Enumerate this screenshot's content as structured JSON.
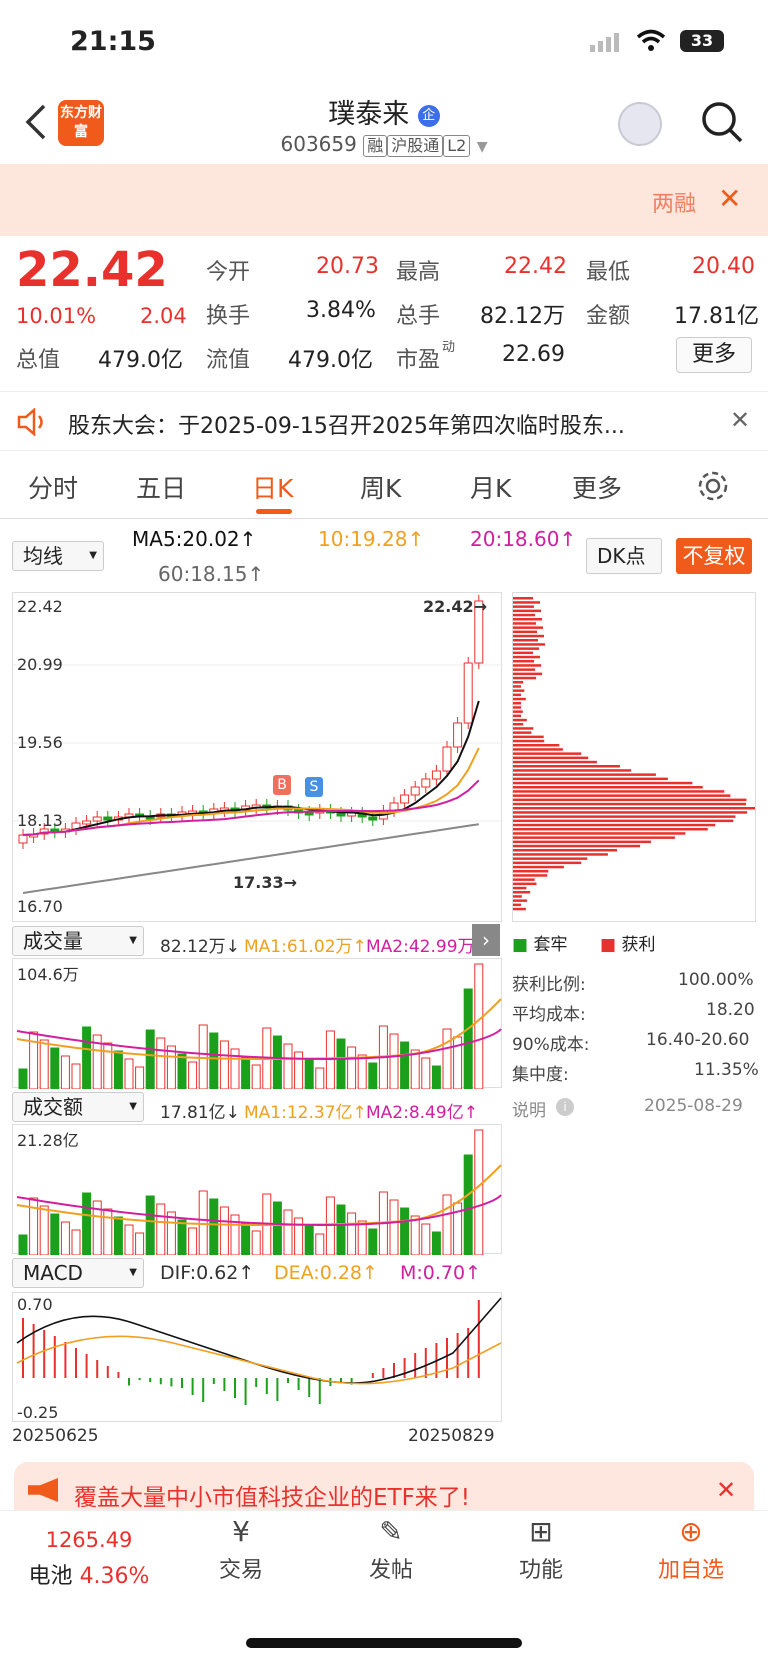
{
  "status": {
    "time": "21:15",
    "battery": "33"
  },
  "header": {
    "logo": "东方财富",
    "title": "璞泰来",
    "badge": "企",
    "code": "603659",
    "tags": [
      "融",
      "沪股通",
      "L2"
    ]
  },
  "banner": {
    "text": "两融"
  },
  "quote": {
    "price": "22.42",
    "pct": "10.01%",
    "chg": "2.04",
    "open_l": "今开",
    "open": "20.73",
    "high_l": "最高",
    "high": "22.42",
    "low_l": "最低",
    "low": "20.40",
    "turn_l": "换手",
    "turn": "3.84%",
    "vol_l": "总手",
    "vol": "82.12万",
    "amt_l": "金额",
    "amt": "17.81亿",
    "mcap_l": "总值",
    "mcap": "479.0亿",
    "float_l": "流值",
    "float": "479.0亿",
    "pe_l": "市盈",
    "pe_sup": "动",
    "pe": "22.69",
    "more": "更多"
  },
  "notice": {
    "text": "股东大会：于2025-09-15召开2025年第四次临时股东..."
  },
  "tabs": [
    "分时",
    "五日",
    "日K",
    "周K",
    "月K",
    "更多"
  ],
  "ma": {
    "select": "均线",
    "ma5": "MA5:20.02↑",
    "ma10": "10:19.28↑",
    "ma20": "20:18.60↑",
    "ma60": "60:18.15↑",
    "dk": "DK点",
    "fq": "不复权"
  },
  "kline": {
    "top": "22.42",
    "y2": "20.99",
    "y3": "19.56",
    "y4": "18.13",
    "bottom": "16.70",
    "hi_ann": "22.42→",
    "lo_ann": "17.33→",
    "b": "B",
    "s": "S"
  },
  "vol": {
    "select": "成交量",
    "val": "82.12万↓",
    "ma1": "MA1:61.02万↑",
    "ma2": "MA2:42.99万↑",
    "max": "104.6万"
  },
  "amt": {
    "select": "成交额",
    "val": "17.81亿↓",
    "ma1": "MA1:12.37亿↑",
    "ma2": "MA2:8.49亿↑",
    "max": "21.28亿"
  },
  "macd": {
    "select": "MACD",
    "dif": "DIF:0.62↑",
    "dea": "DEA:0.28↑",
    "m": "M:0.70↑",
    "top": "0.70",
    "bottom": "-0.25",
    "d1": "20250625",
    "d2": "20250829"
  },
  "chip": {
    "leg1": "套牢",
    "leg2": "获利",
    "r1l": "获利比例:",
    "r1": "100.00%",
    "r2l": "平均成本:",
    "r2": "18.20",
    "r3l": "90%成本:",
    "r3": "16.40-20.60",
    "r4l": "集中度:",
    "r4": "11.35%",
    "note": "说明",
    "date": "2025-08-29"
  },
  "ad": {
    "text": "覆盖大量中小市值科技企业的ETF来了!"
  },
  "bottom": {
    "index": "1265.49",
    "name": "电池",
    "pct": "4.36%",
    "items": [
      "交易",
      "发帖",
      "功能",
      "加自选"
    ]
  },
  "colors": {
    "up": "#e8312d",
    "down": "#1ca01c",
    "accent": "#f05a1a"
  }
}
